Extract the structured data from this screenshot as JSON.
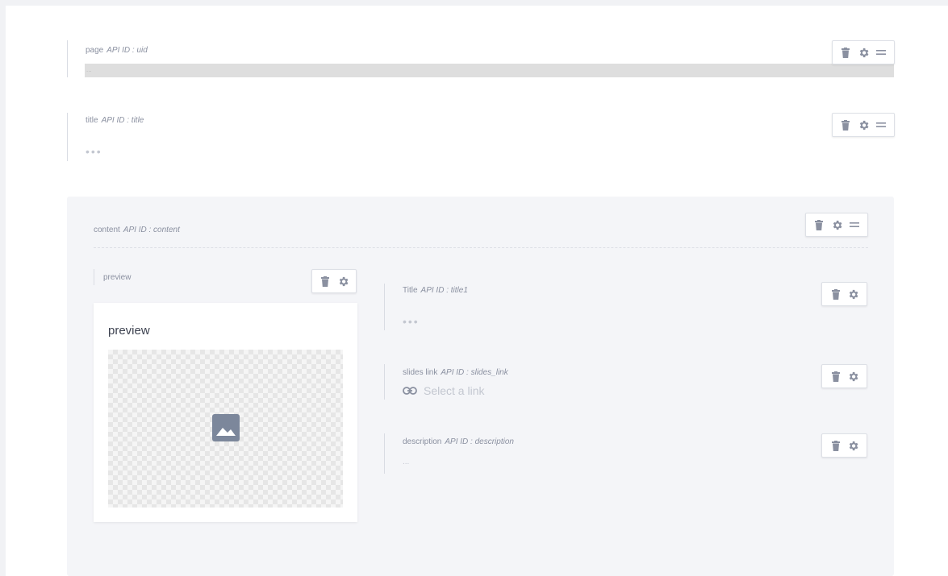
{
  "fields": {
    "page": {
      "label": "page",
      "api": "API ID : uid",
      "value": "..."
    },
    "title": {
      "label": "title",
      "api": "API ID : title",
      "placeholder": "•••"
    }
  },
  "slice": {
    "label": "content",
    "api": "API ID : content",
    "preview": {
      "label": "preview",
      "card_title": "preview"
    },
    "items": [
      {
        "label": "Title",
        "api": "API ID : title1",
        "placeholder": "•••"
      },
      {
        "label": "slides link",
        "api": "API ID : slides_link",
        "placeholder": "Select a link"
      },
      {
        "label": "description",
        "api": "API ID : description",
        "placeholder": "..."
      }
    ]
  },
  "icons": {
    "delete": "trash-icon",
    "settings": "gear-icon",
    "drag": "drag-handle-icon",
    "link": "link-icon",
    "image": "image-icon"
  },
  "colors": {
    "icon": "#8a90a0",
    "slice_bg": "#f4f5f8",
    "image_icon": "#7c879b"
  }
}
